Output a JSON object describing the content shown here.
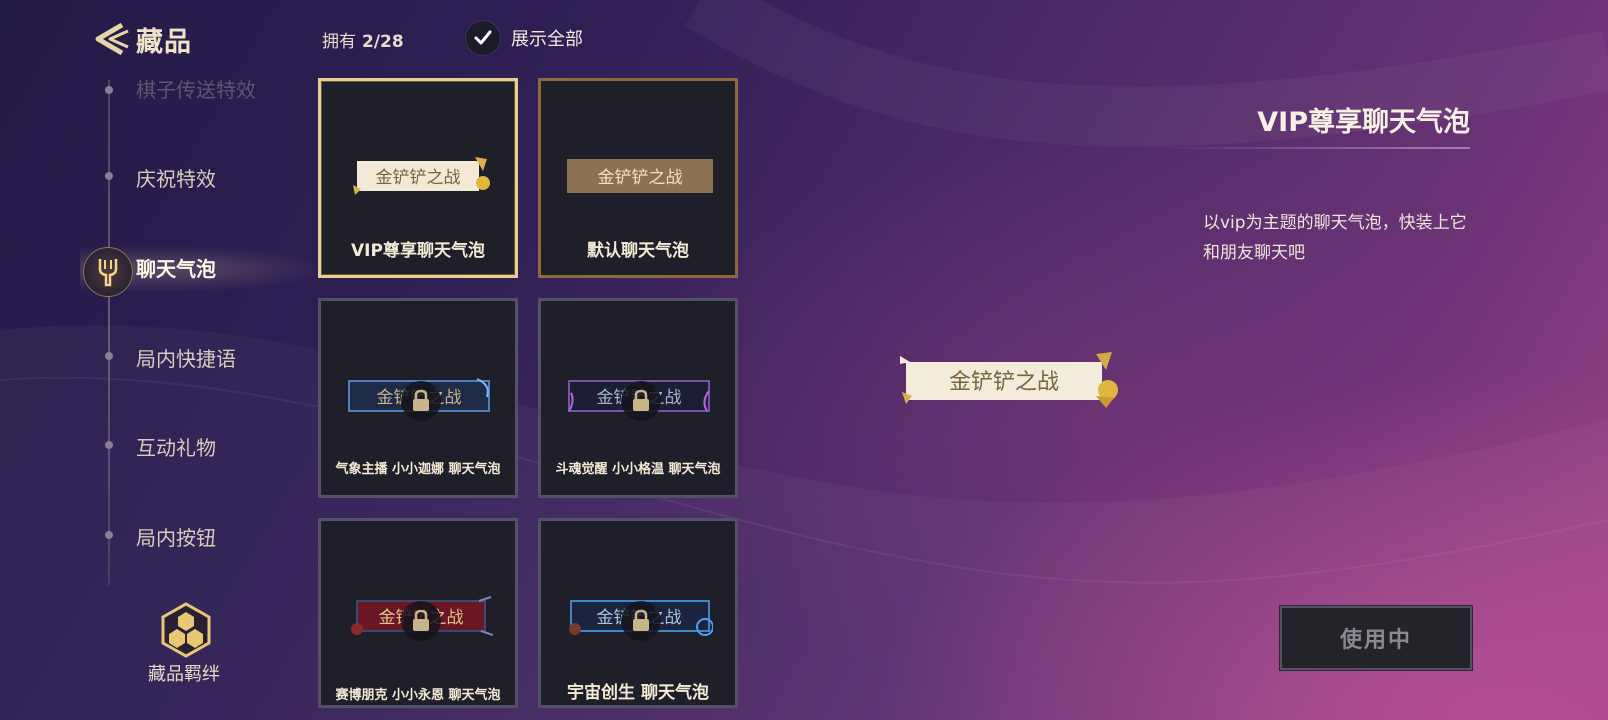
{
  "header": {
    "title": "藏品",
    "owned_label": "拥有",
    "owned_count": "2/28",
    "show_all_label": "展示全部",
    "show_all_checked": true
  },
  "sidebar": {
    "items": [
      {
        "label": "棋子传送特效",
        "state": "faded"
      },
      {
        "label": "庆祝特效",
        "state": "normal"
      },
      {
        "label": "聊天气泡",
        "state": "active"
      },
      {
        "label": "局内快捷语",
        "state": "normal"
      },
      {
        "label": "互动礼物",
        "state": "normal"
      },
      {
        "label": "局内按钮",
        "state": "normal"
      }
    ],
    "bond_label": "藏品羁绊"
  },
  "grid": {
    "bubble_text": "金铲铲之战",
    "cards": [
      {
        "label": "VIP尊享聊天气泡",
        "state": "selected",
        "style": "vip"
      },
      {
        "label": "默认聊天气泡",
        "state": "owned",
        "style": "default"
      },
      {
        "label": "气象主播 小小迦娜 聊天气泡",
        "state": "locked",
        "style": "blue"
      },
      {
        "label": "斗魂觉醒 小小格温 聊天气泡",
        "state": "locked",
        "style": "purple"
      },
      {
        "label": "赛博朋克 小小永恩 聊天气泡",
        "state": "locked",
        "style": "red"
      },
      {
        "label": "宇宙创生 聊天气泡",
        "state": "locked",
        "style": "cosmic"
      }
    ]
  },
  "detail": {
    "title": "VIP尊享聊天气泡",
    "description": "以vip为主题的聊天气泡，快装上它和朋友聊天吧",
    "preview_text": "金铲铲之战",
    "use_button_label": "使用中"
  },
  "colors": {
    "gold_border": "#e6cf91",
    "owned_border": "#8c6a3c",
    "locked_border": "#55506a",
    "card_bg": "#1f1f2a"
  }
}
